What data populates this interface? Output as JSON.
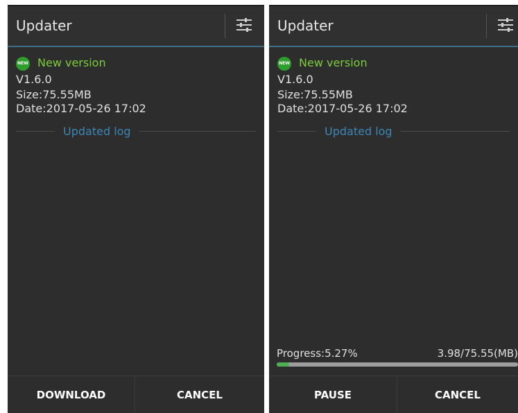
{
  "screens": {
    "download": {
      "title": "Updater",
      "badge": "NEW",
      "new_version_label": "New version",
      "version": "V1.6.0",
      "size": "Size:75.55MB",
      "date": "Date:2017-05-26 17:02",
      "log_label": "Updated log",
      "buttons": {
        "primary": "DOWNLOAD",
        "cancel": "CANCEL"
      }
    },
    "downloading": {
      "title": "Updater",
      "badge": "NEW",
      "new_version_label": "New version",
      "version": "V1.6.0",
      "size": "Size:75.55MB",
      "date": "Date:2017-05-26 17:02",
      "log_label": "Updated log",
      "progress_text": "Progress:5.27%",
      "progress_size": "3.98/75.55(MB)",
      "progress_percent": 5.27,
      "buttons": {
        "primary": "PAUSE",
        "cancel": "CANCEL"
      }
    }
  },
  "icons": {
    "settings": "sliders-icon",
    "badge": "new-badge-icon"
  },
  "colors": {
    "background": "#2d2d2d",
    "header_underline": "#3f6f88",
    "new_version_text": "#7ccd3c",
    "new_badge": "#2e9f2e",
    "log_label": "#3d87b5",
    "progress_fill": "#4caf50",
    "progress_track": "#9e9e9e"
  }
}
